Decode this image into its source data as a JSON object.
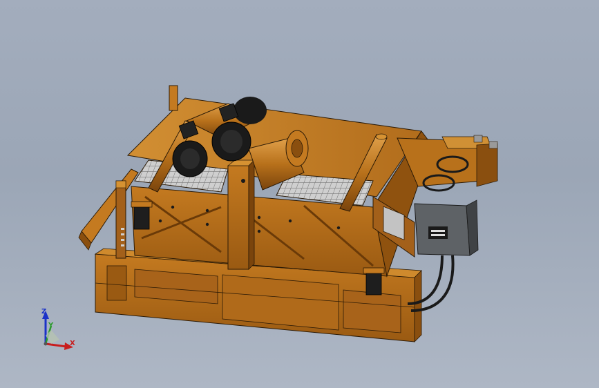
{
  "viewport": {
    "background": "#a3adbd",
    "model": {
      "body_color": "#b8711b",
      "shadow_color": "#8a4f0f",
      "highlight_color": "#d69232",
      "screen_color": "#c9c9c9",
      "motor_color": "#1a1a1a",
      "junction_box_color": "#5e6266"
    }
  },
  "triad": {
    "z_label": "Z",
    "y_label": "Y",
    "x_label": "X",
    "z_color": "#1b32c8",
    "y_color": "#2a9a2a",
    "x_color": "#c81e1e"
  }
}
